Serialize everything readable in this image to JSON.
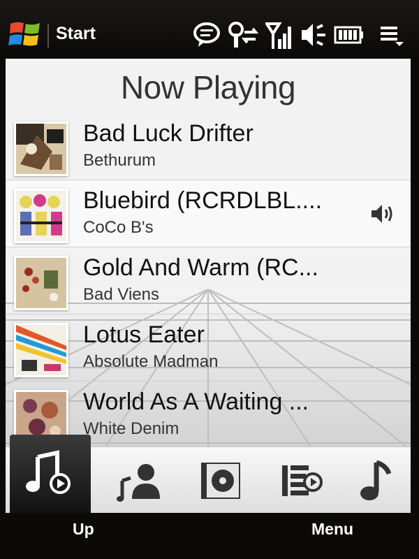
{
  "status_bar": {
    "start_label": "Start",
    "icons": [
      "windows-logo",
      "message-icon",
      "data-connection-icon",
      "signal-icon",
      "volume-mute-icon",
      "battery-icon",
      "notification-list-icon"
    ]
  },
  "screen": {
    "title": "Now Playing",
    "tracks": [
      {
        "title": "Bad Luck Drifter",
        "artist": "Bethurum",
        "playing": false
      },
      {
        "title": "Bluebird (RCRDLBL....",
        "artist": "CoCo B's",
        "playing": true
      },
      {
        "title": "Gold And Warm (RC...",
        "artist": "Bad Viens",
        "playing": false
      },
      {
        "title": "Lotus Eater",
        "artist": "Absolute Madman",
        "playing": false
      },
      {
        "title": "World As A Waiting ...",
        "artist": "White Denim",
        "playing": false
      }
    ]
  },
  "tabs": [
    "now-playing-icon",
    "artists-icon",
    "albums-icon",
    "playlists-icon",
    "songs-icon"
  ],
  "softkeys": {
    "left": "Up",
    "right": "Menu"
  },
  "colors": {
    "background": "#0c0a09",
    "panel": "#f2f2f2",
    "active_tab": "#1e1e1e"
  }
}
